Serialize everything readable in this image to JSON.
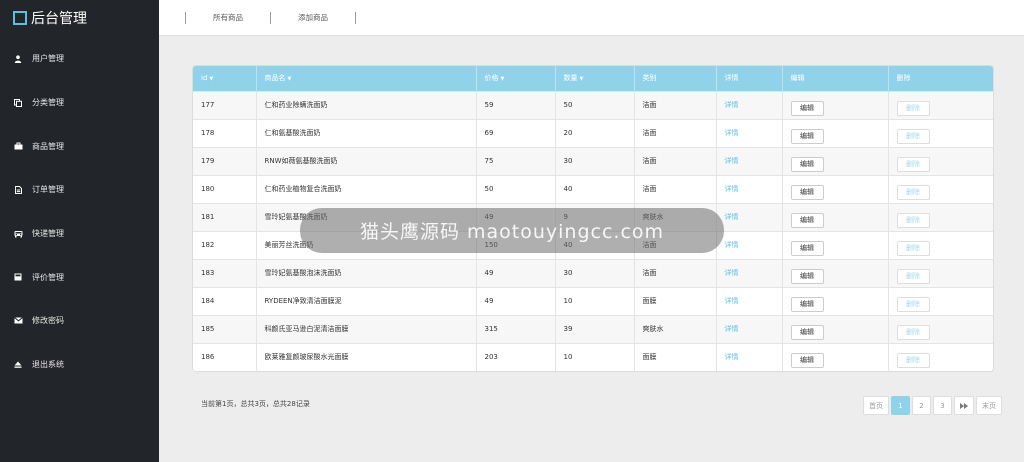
{
  "brand": {
    "title": "后台管理"
  },
  "sidebar": {
    "items": [
      {
        "label": "用户管理",
        "icon": "user-icon"
      },
      {
        "label": "分类管理",
        "icon": "copy-icon"
      },
      {
        "label": "商品管理",
        "icon": "shopping-bag-icon"
      },
      {
        "label": "订单管理",
        "icon": "file-icon"
      },
      {
        "label": "快递管理",
        "icon": "car-icon"
      },
      {
        "label": "评价管理",
        "icon": "book-icon"
      },
      {
        "label": "修改密码",
        "icon": "envelope-icon"
      },
      {
        "label": "退出系统",
        "icon": "eject-icon"
      }
    ]
  },
  "tabs": [
    "所有商品",
    "添加商品"
  ],
  "table": {
    "headers": {
      "id": "id",
      "name": "商品名",
      "price": "价格",
      "qty": "数量",
      "category": "类别",
      "detail": "详情",
      "edit": "编辑",
      "delete": "删除"
    },
    "rows": [
      {
        "id": "177",
        "name": "仁和药业除螨洗面奶",
        "price": "59",
        "qty": "50",
        "category": "洁面",
        "detail": "详情",
        "edit": "编辑",
        "delete": "删除"
      },
      {
        "id": "178",
        "name": "仁和氨基酸洗面奶",
        "price": "69",
        "qty": "20",
        "category": "洁面",
        "detail": "详情",
        "edit": "编辑",
        "delete": "删除"
      },
      {
        "id": "179",
        "name": "RNW如薇氨基酸洗面奶",
        "price": "75",
        "qty": "30",
        "category": "洁面",
        "detail": "详情",
        "edit": "编辑",
        "delete": "删除"
      },
      {
        "id": "180",
        "name": "仁和药业植物复合洗面奶",
        "price": "50",
        "qty": "40",
        "category": "洁面",
        "detail": "详情",
        "edit": "编辑",
        "delete": "删除"
      },
      {
        "id": "181",
        "name": "雪玲妃氨基酸洗面奶",
        "price": "49",
        "qty": "9",
        "category": "爽肤水",
        "detail": "详情",
        "edit": "编辑",
        "delete": "删除"
      },
      {
        "id": "182",
        "name": "美丽芳丝洗面奶",
        "price": "150",
        "qty": "40",
        "category": "洁面",
        "detail": "详情",
        "edit": "编辑",
        "delete": "删除"
      },
      {
        "id": "183",
        "name": "雪玲妃氨基酸泡沫洗面奶",
        "price": "49",
        "qty": "30",
        "category": "洁面",
        "detail": "详情",
        "edit": "编辑",
        "delete": "删除"
      },
      {
        "id": "184",
        "name": "RYDEEN净致清洁面膜泥",
        "price": "49",
        "qty": "10",
        "category": "面膜",
        "detail": "详情",
        "edit": "编辑",
        "delete": "删除"
      },
      {
        "id": "185",
        "name": "科颜氏亚马逊白泥清洁面膜",
        "price": "315",
        "qty": "39",
        "category": "爽肤水",
        "detail": "详情",
        "edit": "编辑",
        "delete": "删除"
      },
      {
        "id": "186",
        "name": "欧莱雅复颜玻尿酸水光面膜",
        "price": "203",
        "qty": "10",
        "category": "面膜",
        "detail": "详情",
        "edit": "编辑",
        "delete": "删除"
      }
    ]
  },
  "pagination": {
    "info": "当前第1页，总共3页，总共28记录",
    "first": "首页",
    "pages": [
      "1",
      "2",
      "3"
    ],
    "active_page": "1",
    "next_icon": "fast-forward-icon",
    "last": "末页"
  },
  "watermark": {
    "text": "猫头鹰源码 maotouyingcc.com"
  },
  "colors": {
    "sidebar_bg": "#222529",
    "header_bg": "#90d2ea",
    "accent": "#5bc0de",
    "page_bg": "#ededed"
  }
}
